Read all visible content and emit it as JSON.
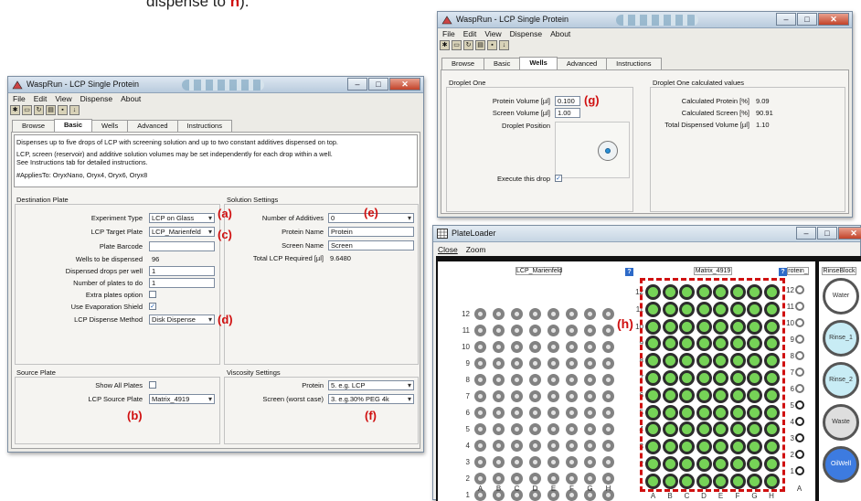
{
  "caption": "dispense to ",
  "caption_h": "h",
  "caption_end": ").",
  "win1": {
    "title": "WaspRun - LCP Single Protein",
    "menu": [
      "File",
      "Edit",
      "View",
      "Dispense",
      "About"
    ],
    "tabs": [
      "Browse",
      "Basic",
      "Wells",
      "Advanced",
      "Instructions"
    ],
    "description": [
      "Dispenses up to five drops of LCP with screening solution and up to two constant additives dispensed on top.",
      "LCP, screen (reservoir) and additive solution volumes may be set independently for each drop within a well.",
      "See Instructions tab for detailed instructions.",
      "#AppliesTo: OryxNano, Oryx4, Oryx6, Oryx8"
    ],
    "dest": {
      "title": "Destination Plate",
      "experiment_type_label": "Experiment Type",
      "experiment_type": "LCP on Glass",
      "target_plate_label": "LCP Target Plate",
      "target_plate": "LCP_Marienfeld",
      "barcode_label": "Plate Barcode",
      "barcode": "",
      "wells_label": "Wells to be dispensed",
      "wells": "96",
      "drops_label": "Dispensed drops per well",
      "drops": "1",
      "plates_label": "Number of plates to do",
      "plates": "1",
      "extra_label": "Extra plates option",
      "evap_label": "Use Evaporation Shield",
      "method_label": "LCP Dispense Method",
      "method": "Disk Dispense"
    },
    "sol": {
      "title": "Solution Settings",
      "additives_label": "Number of Additives",
      "additives": "0",
      "protein_name_label": "Protein Name",
      "protein_name": "Protein",
      "screen_name_label": "Screen Name",
      "screen_name": "Screen",
      "total_label": "Total LCP Required [µl]",
      "total": "9.6480"
    },
    "source": {
      "title": "Source Plate",
      "show_all_label": "Show All Plates",
      "source_plate_label": "LCP Source Plate",
      "source_plate": "Matrix_4919"
    },
    "visc": {
      "title": "Viscosity Settings",
      "protein_label": "Protein",
      "protein": "5. e.g. LCP",
      "screen_label": "Screen (worst case)",
      "screen": "3. e.g.30% PEG 4k"
    }
  },
  "win2": {
    "title": "WaspRun - LCP Single Protein",
    "menu": [
      "File",
      "Edit",
      "View",
      "Dispense",
      "About"
    ],
    "tabs": [
      "Browse",
      "Basic",
      "Wells",
      "Advanced",
      "Instructions"
    ],
    "droplet": {
      "title": "Droplet One",
      "protein_vol_label": "Protein Volume [µl]",
      "protein_vol": "0.100",
      "screen_vol_label": "Screen Volume [µl]",
      "screen_vol": "1.00",
      "position_label": "Droplet Position",
      "execute_label": "Execute this drop"
    },
    "calc": {
      "title": "Droplet One calculated values",
      "protein_label": "Calculated Protein [%]",
      "protein": "9.09",
      "screen_label": "Calculated Screen [%]",
      "screen": "90.91",
      "total_label": "Total Dispensed Volume [µl]",
      "total": "1.10"
    }
  },
  "win3": {
    "title": "PlateLoader",
    "menu": [
      "Close",
      "Zoom"
    ],
    "left_plate": "LCP_Marienfeld",
    "right_plate": "Matrix_4919",
    "protein_col": "rotein_",
    "rinse_col": "RinseBlock",
    "help": "?",
    "row_labels": [
      "12",
      "11",
      "10",
      "9",
      "8",
      "7",
      "6",
      "5",
      "4",
      "3",
      "2",
      "1"
    ],
    "col_labels": [
      "A",
      "B",
      "C",
      "D",
      "E",
      "F",
      "G",
      "H"
    ],
    "protein_col_label": "A",
    "reservoirs": [
      "Water",
      "Rinse_1",
      "Rinse_2",
      "Waste",
      "OilWell"
    ]
  },
  "annotations": {
    "a": "(a)",
    "b": "(b)",
    "c": "(c)",
    "d": "(d)",
    "e": "(e)",
    "f": "(f)",
    "g": "(g)",
    "h": "(h)"
  },
  "colors": {
    "annotation": "#d01010",
    "well_green": "#76d357",
    "oil": "#3d7be0",
    "rinse": "#c8ecf5"
  }
}
